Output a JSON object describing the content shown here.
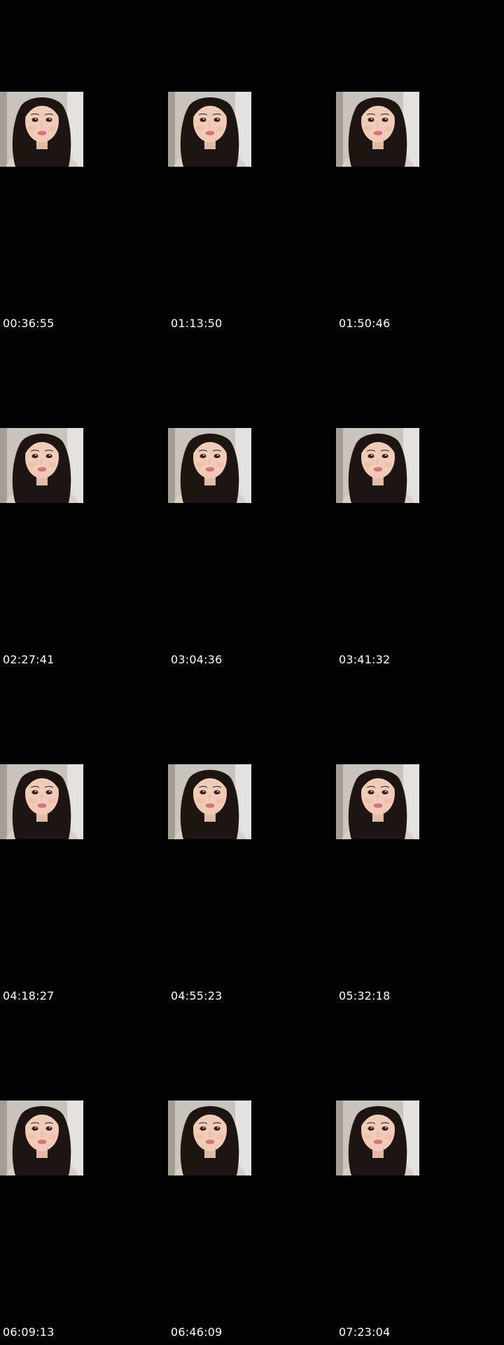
{
  "frames": [
    {
      "timestamp": "00:36:55"
    },
    {
      "timestamp": "01:13:50"
    },
    {
      "timestamp": "01:50:46"
    },
    {
      "timestamp": "02:27:41"
    },
    {
      "timestamp": "03:04:36"
    },
    {
      "timestamp": "03:41:32"
    },
    {
      "timestamp": "04:18:27"
    },
    {
      "timestamp": "04:55:23"
    },
    {
      "timestamp": "05:32:18"
    },
    {
      "timestamp": "06:09:13"
    },
    {
      "timestamp": "06:46:09"
    },
    {
      "timestamp": "07:23:04"
    }
  ],
  "colors": {
    "background": "#030304",
    "timestamp_text": "#ffffff"
  },
  "icons": {
    "thumbnail": "portrait-thumbnail"
  }
}
